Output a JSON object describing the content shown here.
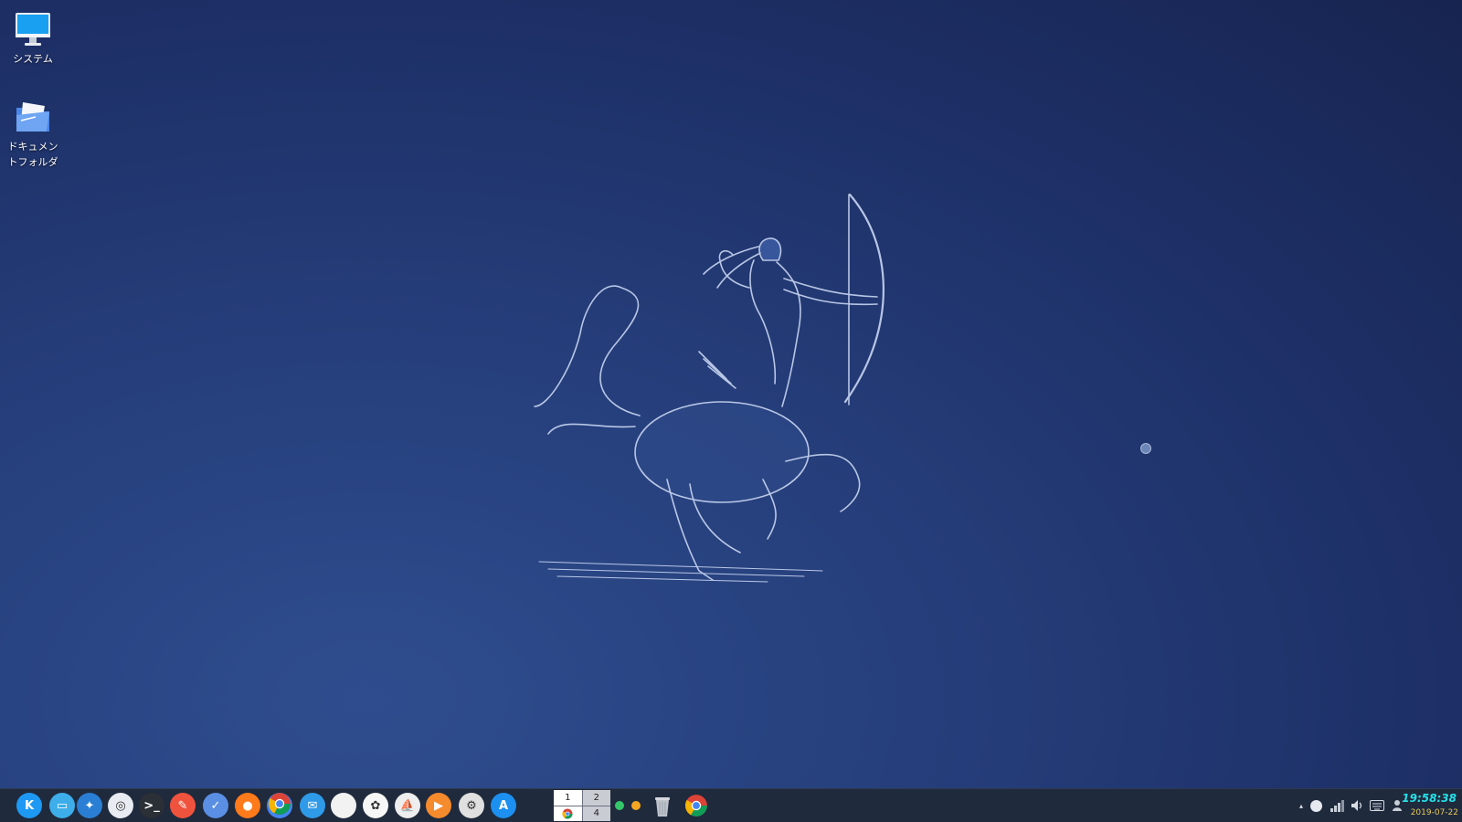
{
  "desktop": {
    "icons": [
      {
        "label": "システム",
        "icon": "monitor-icon"
      },
      {
        "label": "ドキュメン\nトフォルダ",
        "icon": "folder-icon"
      }
    ],
    "wallpaper": "centaur-archer-sagittarius"
  },
  "taskbar": {
    "launchers": [
      {
        "name": "kde-menu",
        "color": "#1d99f3"
      },
      {
        "name": "file-manager",
        "color": "#3daee9"
      },
      {
        "name": "system-settings-star",
        "color": "#2a7fd4"
      },
      {
        "name": "screen-capture",
        "color": "#e8ecf2"
      },
      {
        "name": "terminal",
        "color": "#2b2f36"
      },
      {
        "name": "text-editor",
        "color": "#f0533d"
      },
      {
        "name": "documents-folder",
        "color": "#5b8fe3"
      },
      {
        "name": "firefox",
        "color": "#ff7a1a"
      },
      {
        "name": "chrome",
        "color": "#4285f4"
      },
      {
        "name": "mail",
        "color": "#2f9ae8"
      },
      {
        "name": "notes",
        "color": "#f2f2f2"
      },
      {
        "name": "photos",
        "color": "#f6f6f6"
      },
      {
        "name": "sequel-pro",
        "color": "#eeeeee"
      },
      {
        "name": "media-player",
        "color": "#f58b2d"
      },
      {
        "name": "preferences",
        "color": "#e0e0e0"
      },
      {
        "name": "app-store",
        "color": "#1c8ff0"
      }
    ],
    "pager": {
      "desktops": [
        "1",
        "2",
        "",
        "4"
      ],
      "active": "1"
    },
    "indicators": [
      {
        "color": "#35c66a"
      },
      {
        "color": "#f5a623"
      }
    ],
    "tasks": [
      {
        "name": "chrome-window"
      }
    ],
    "tray": [
      "arrow-up-icon",
      "chat-icon",
      "network-icon",
      "volume-icon",
      "keyboard-icon",
      "user-icon"
    ],
    "clock": {
      "time": "19:58:38",
      "date": "2019-07-22"
    }
  }
}
